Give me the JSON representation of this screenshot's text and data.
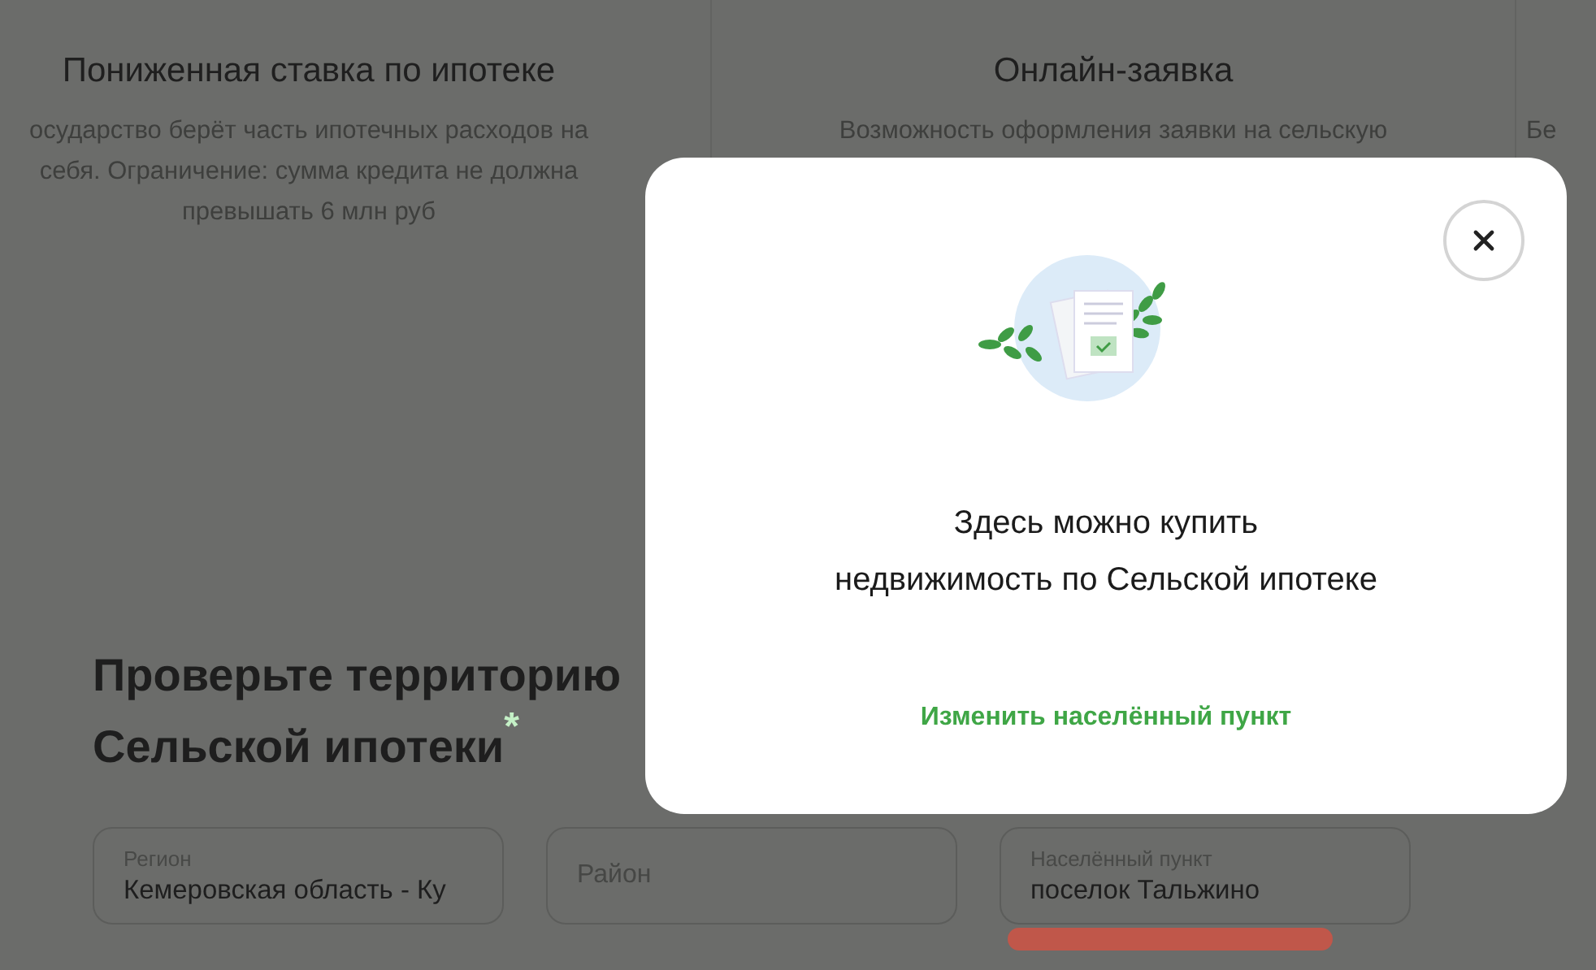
{
  "cards": [
    {
      "title": "Пониженная ставка по ипотеке",
      "lines": [
        "осударство берёт часть ипотечных расходов на",
        "себя. Ограничение: сумма кредита не должна",
        "превышать 6 млн руб"
      ]
    },
    {
      "title": "Онлайн-заявка",
      "lines": [
        "Возможность оформления заявки на сельскую"
      ]
    },
    {
      "lines": [
        "Бе"
      ]
    }
  ],
  "form": {
    "heading": [
      "Проверьте территорию",
      "Сельской ипотеки"
    ],
    "required_mark": "*",
    "fields": [
      {
        "label": "Регион",
        "value": "Кемеровская область - Ку"
      },
      {
        "placeholder": "Район"
      },
      {
        "label": "Населённый пункт",
        "value": "поселок Тальжино",
        "marked": true
      }
    ]
  },
  "modal": {
    "message": [
      "Здесь можно купить",
      "недвижимость по Сельской ипотеке"
    ],
    "link": "Изменить населённый пункт"
  }
}
